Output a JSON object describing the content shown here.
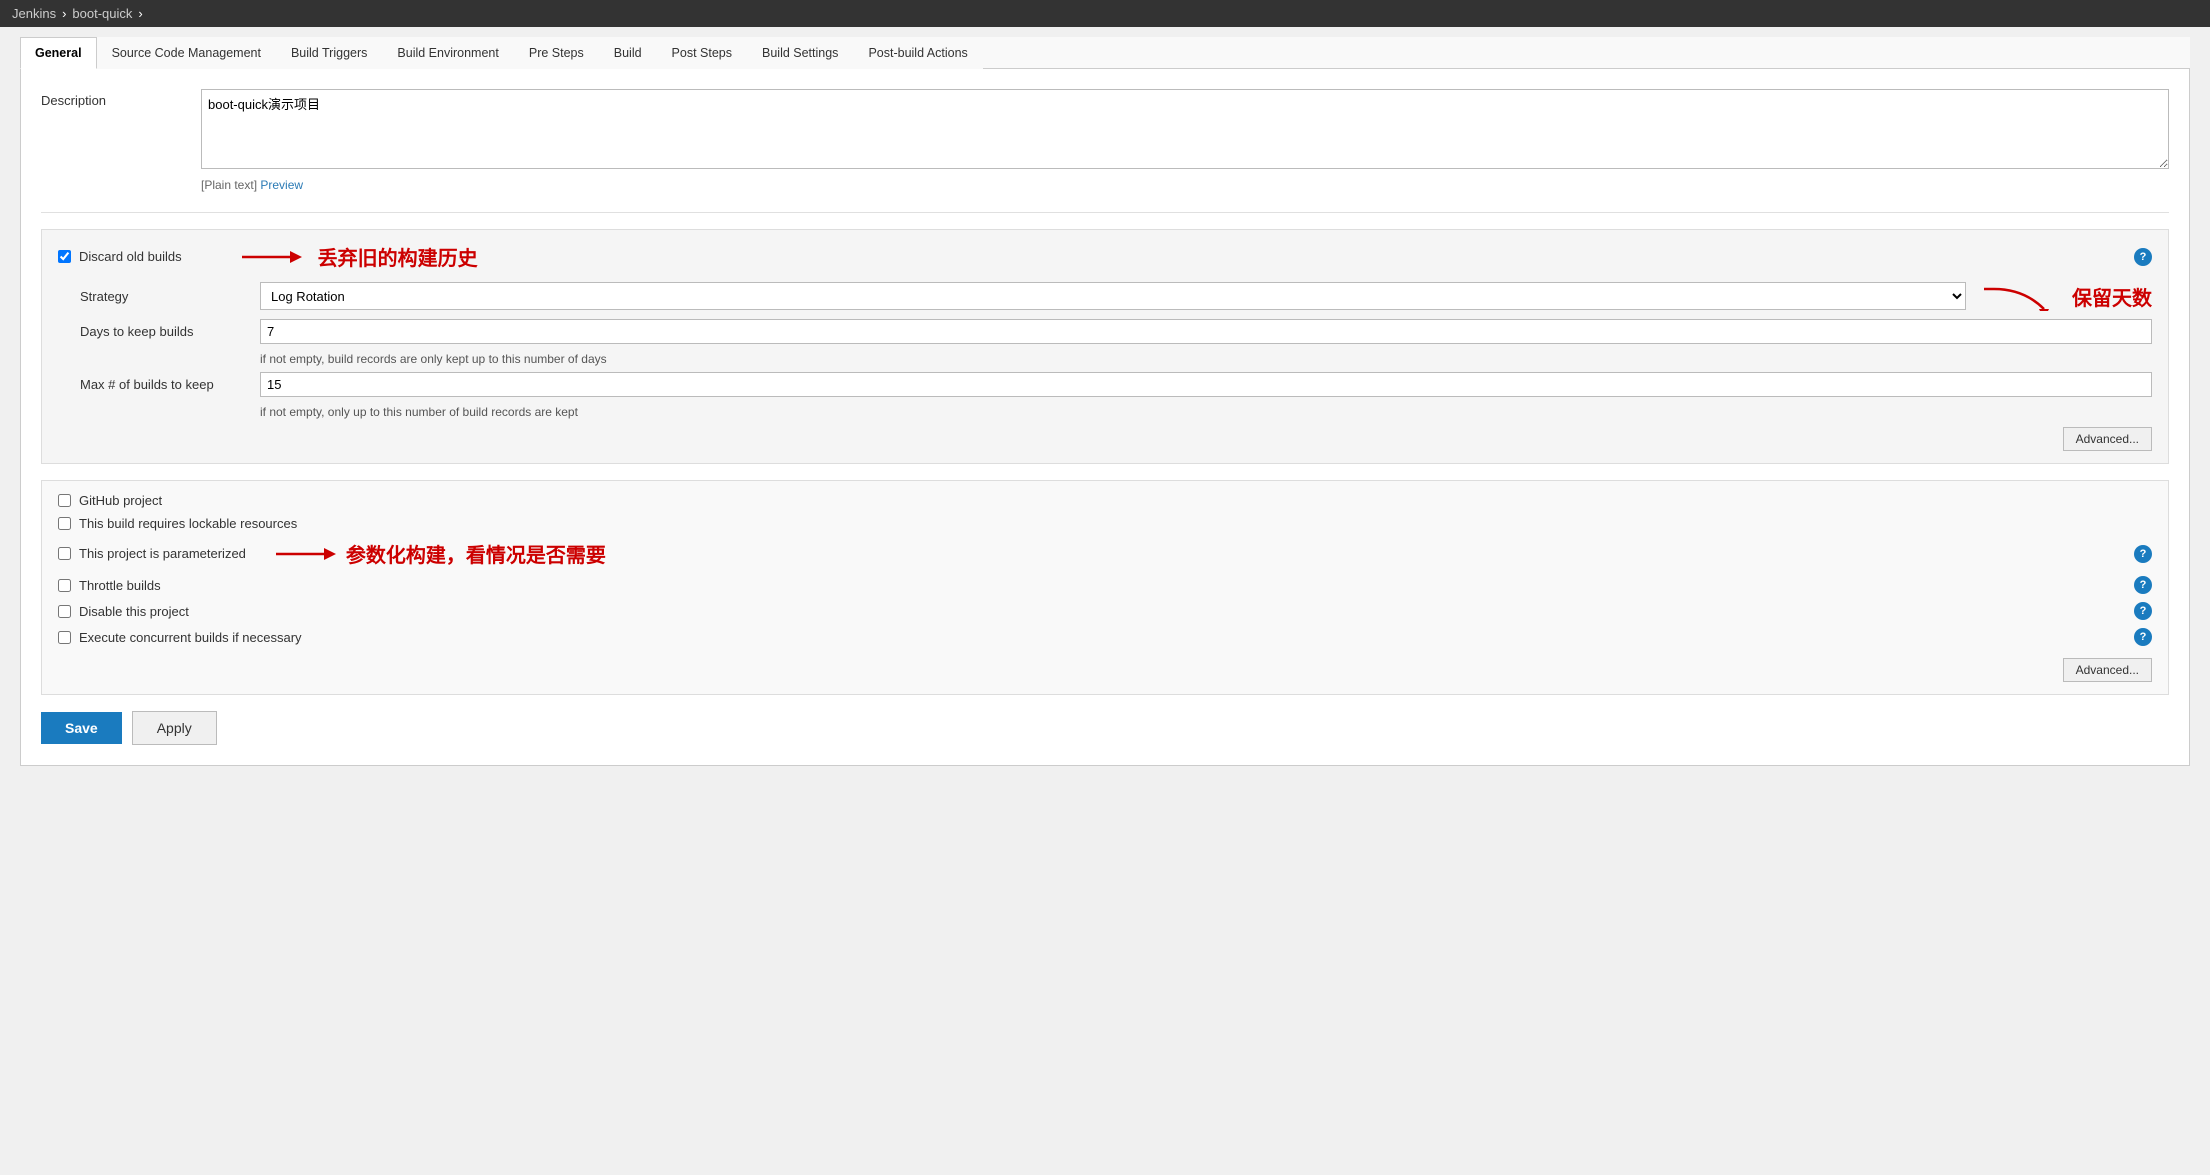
{
  "topbar": {
    "jenkins": "Jenkins",
    "sep1": "›",
    "project": "boot-quick",
    "sep2": "›"
  },
  "tabs": [
    {
      "id": "general",
      "label": "General",
      "active": true
    },
    {
      "id": "scm",
      "label": "Source Code Management",
      "active": false
    },
    {
      "id": "build-triggers",
      "label": "Build Triggers",
      "active": false
    },
    {
      "id": "build-environment",
      "label": "Build Environment",
      "active": false
    },
    {
      "id": "pre-steps",
      "label": "Pre Steps",
      "active": false
    },
    {
      "id": "build",
      "label": "Build",
      "active": false
    },
    {
      "id": "post-steps",
      "label": "Post Steps",
      "active": false
    },
    {
      "id": "build-settings",
      "label": "Build Settings",
      "active": false
    },
    {
      "id": "post-build-actions",
      "label": "Post-build Actions",
      "active": false
    }
  ],
  "description": {
    "label": "Description",
    "value": "boot-quick演示项目",
    "plain_text_prefix": "[Plain text]",
    "preview_link": "Preview"
  },
  "discard_old_builds": {
    "label": "Discard old builds",
    "checked": true,
    "annotation": "丢弃旧的构建历史",
    "strategy_label": "Strategy",
    "strategy_value": "Log Rotation",
    "strategy_options": [
      "Log Rotation"
    ],
    "days_label": "Days to keep builds",
    "days_value": "7",
    "days_hint": "if not empty, build records are only kept up to this number of days",
    "max_label": "Max # of builds to keep",
    "max_value": "15",
    "max_hint": "if not empty, only up to this number of build records are kept",
    "advanced_btn": "Advanced...",
    "days_annotation": "保留天数"
  },
  "checkboxes": [
    {
      "id": "github-project",
      "label": "GitHub project",
      "checked": false,
      "has_help": false
    },
    {
      "id": "lockable-resources",
      "label": "This build requires lockable resources",
      "checked": false,
      "has_help": false
    },
    {
      "id": "parameterized",
      "label": "This project is parameterized",
      "checked": false,
      "has_help": true,
      "annotation": "参数化构建，看情况是否需要"
    },
    {
      "id": "throttle",
      "label": "Throttle builds",
      "checked": false,
      "has_help": true
    },
    {
      "id": "disable",
      "label": "Disable this project",
      "checked": false,
      "has_help": true
    },
    {
      "id": "concurrent",
      "label": "Execute concurrent builds if necessary",
      "checked": false,
      "has_help": true
    }
  ],
  "advanced_bottom_btn": "Advanced...",
  "save_btn": "Save",
  "apply_btn": "Apply"
}
